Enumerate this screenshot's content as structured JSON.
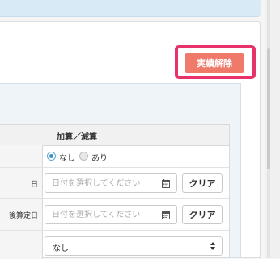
{
  "header": {
    "action_button_label": "実績解除"
  },
  "form": {
    "column_header": "加算／減算",
    "adjustment": {
      "options": [
        "なし",
        "あり"
      ],
      "selected": "なし"
    },
    "rows": [
      {
        "label": "日",
        "placeholder": "日付を選択してください",
        "clear_label": "クリア"
      },
      {
        "label": "後算定日",
        "placeholder": "日付を選択してください",
        "clear_label": "クリア"
      }
    ],
    "select": {
      "value": "なし"
    }
  },
  "colors": {
    "action_button": "#ef7a6a",
    "highlight_border": "#e8336a",
    "radio_selected": "#3d8fc4"
  },
  "icons": [
    "calendar-icon",
    "select-arrows-icon"
  ]
}
